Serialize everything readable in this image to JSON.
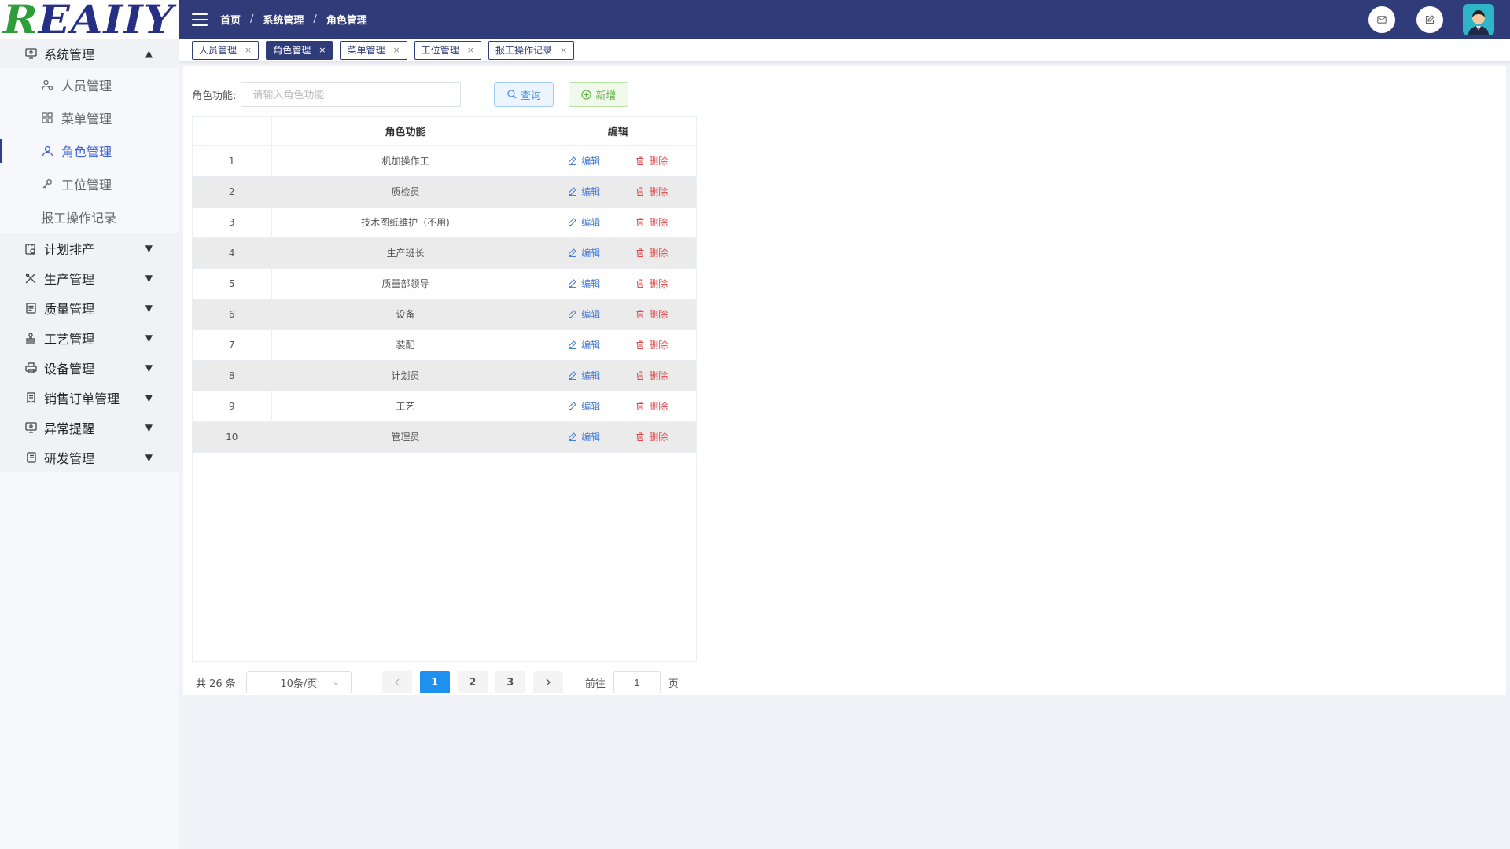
{
  "logo": {
    "text_first": "R",
    "text_rest": "EAIIY"
  },
  "sidebar": {
    "system": {
      "label": "系统管理",
      "items": [
        {
          "label": "人员管理",
          "icon": "user-group-icon"
        },
        {
          "label": "菜单管理",
          "icon": "grid-icon"
        },
        {
          "label": "角色管理",
          "icon": "user-icon",
          "active": true
        },
        {
          "label": "工位管理",
          "icon": "key-icon"
        },
        {
          "label": "报工操作记录",
          "icon": ""
        }
      ]
    },
    "groups": [
      {
        "label": "计划排产",
        "icon": "calendar-icon"
      },
      {
        "label": "生产管理",
        "icon": "tools-icon"
      },
      {
        "label": "质量管理",
        "icon": "document-icon"
      },
      {
        "label": "工艺管理",
        "icon": "stamp-icon"
      },
      {
        "label": "设备管理",
        "icon": "printer-icon"
      },
      {
        "label": "销售订单管理",
        "icon": "receipt-icon"
      },
      {
        "label": "异常提醒",
        "icon": "monitor-icon"
      },
      {
        "label": "研发管理",
        "icon": "notebook-icon"
      }
    ]
  },
  "topbar": {
    "breadcrumb": [
      "首页",
      "系统管理",
      "角色管理"
    ],
    "separator": "/"
  },
  "tabs": [
    {
      "label": "人员管理",
      "active": false
    },
    {
      "label": "角色管理",
      "active": true
    },
    {
      "label": "菜单管理",
      "active": false
    },
    {
      "label": "工位管理",
      "active": false
    },
    {
      "label": "报工操作记录",
      "active": false
    }
  ],
  "tab_close": "×",
  "search": {
    "label": "角色功能:",
    "placeholder": "请输入角色功能",
    "value": "",
    "query_label": "查询",
    "add_label": "新增"
  },
  "table": {
    "headers": [
      "",
      "角色功能",
      "编辑"
    ],
    "edit_label": "编辑",
    "delete_label": "删除",
    "rows": [
      {
        "index": "1",
        "role": "机加操作工"
      },
      {
        "index": "2",
        "role": "质检员"
      },
      {
        "index": "3",
        "role": "技术图纸维护（不用)"
      },
      {
        "index": "4",
        "role": "生产班长"
      },
      {
        "index": "5",
        "role": "质量部领导"
      },
      {
        "index": "6",
        "role": "设备"
      },
      {
        "index": "7",
        "role": "装配"
      },
      {
        "index": "8",
        "role": "计划员"
      },
      {
        "index": "9",
        "role": "工艺"
      },
      {
        "index": "10",
        "role": "管理员"
      }
    ]
  },
  "pagination": {
    "total": "共 26 条",
    "page_size": "10条/页",
    "pages": [
      "1",
      "2",
      "3"
    ],
    "current": "1",
    "goto_prefix": "前往",
    "goto_value": "1",
    "goto_suffix": "页"
  },
  "colors": {
    "primary": "#303b7a",
    "active_menu": "#3d5fd6",
    "edit": "#4a7fd6",
    "delete": "#e0474a",
    "page_active": "#1e90ef"
  }
}
